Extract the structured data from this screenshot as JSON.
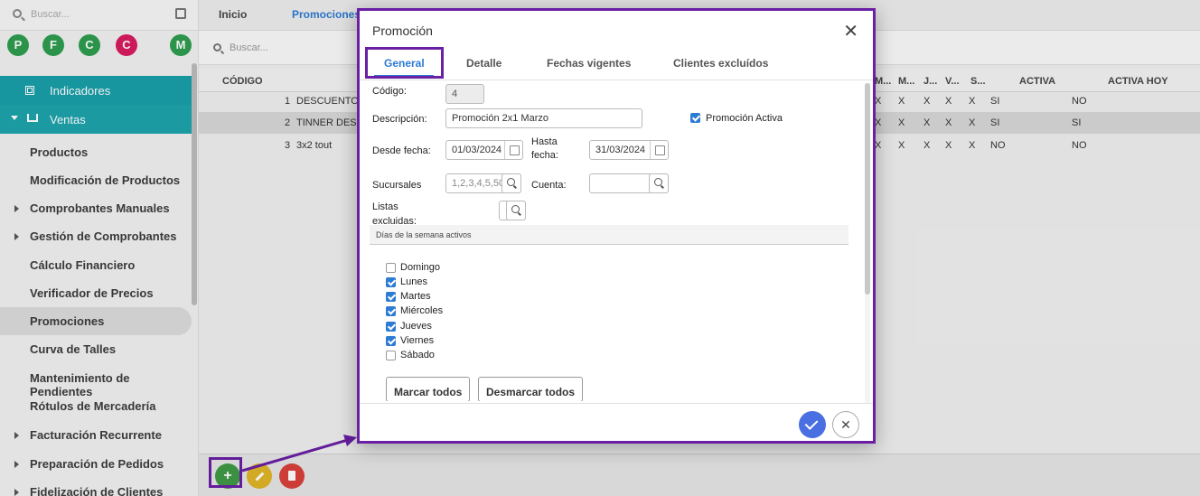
{
  "sidebar": {
    "search_placeholder": "Buscar...",
    "favorites": [
      {
        "letter": "P",
        "color": "#2e9e4f"
      },
      {
        "letter": "F",
        "color": "#2e9e4f"
      },
      {
        "letter": "C",
        "color": "#2e9e4f"
      },
      {
        "letter": "C",
        "color": "#d81b60"
      },
      {
        "letter": "M",
        "color": "#2e9e4f"
      }
    ],
    "section_indicadores": "Indicadores",
    "section_ventas": "Ventas",
    "items": [
      {
        "label": "Productos"
      },
      {
        "label": "Modificación de Productos"
      },
      {
        "label": "Comprobantes Manuales"
      },
      {
        "label": "Gestión de Comprobantes"
      },
      {
        "label": "Cálculo Financiero"
      },
      {
        "label": "Verificador de Precios"
      },
      {
        "label": "Promociones"
      },
      {
        "label": "Curva de Talles"
      },
      {
        "label": "Mantenimiento de Pendientes"
      },
      {
        "label": "Rótulos de Mercadería"
      },
      {
        "label": "Facturación Recurrente"
      },
      {
        "label": "Preparación de Pedidos"
      },
      {
        "label": "Fidelización de Clientes"
      }
    ]
  },
  "tabs": {
    "inicio": "Inicio",
    "promociones": "Promociones"
  },
  "main_search_placeholder": "Buscar...",
  "grid": {
    "headers": {
      "codigo": "CÓDIGO",
      "m1": "M...",
      "m2": "M...",
      "j": "J...",
      "v": "V...",
      "s": "S...",
      "activa": "ACTIVA",
      "activa_hoy": "ACTIVA HOY"
    },
    "rows": [
      {
        "codigo": "1",
        "desc": "DESCUENTO V",
        "x1": "X",
        "x2": "X",
        "x3": "X",
        "x4": "X",
        "x5": "X",
        "activa": "SI",
        "activa_hoy": "NO"
      },
      {
        "codigo": "2",
        "desc": "TINNER DESCU",
        "x1": "X",
        "x2": "X",
        "x3": "X",
        "x4": "X",
        "x5": "X",
        "activa": "SI",
        "activa_hoy": "SI"
      },
      {
        "codigo": "3",
        "desc": "3x2 tout",
        "x1": "X",
        "x2": "X",
        "x3": "X",
        "x4": "X",
        "x5": "X",
        "activa": "NO",
        "activa_hoy": "NO"
      }
    ]
  },
  "fab": {
    "add": "+"
  },
  "modal": {
    "title": "Promoción",
    "close": "✕",
    "tabs": [
      "General",
      "Detalle",
      "Fechas vigentes",
      "Clientes excluídos"
    ],
    "codigo_label": "Código:",
    "codigo_value": "4",
    "descripcion_label": "Descripción:",
    "descripcion_value": "Promoción 2x1 Marzo",
    "promo_activa_label": "Promoción Activa",
    "desde_label": "Desde fecha:",
    "desde_value": "01/03/2024",
    "hasta_label_1": "Hasta",
    "hasta_label_2": "fecha:",
    "hasta_value": "31/03/2024",
    "sucursales_label": "Sucursales",
    "sucursales_value": "1,2,3,4,5,50",
    "cuenta_label": "Cuenta:",
    "listas_label_1": "Listas",
    "listas_label_2": "excluidas:",
    "dias_header": "Días de la semana activos",
    "dias": [
      {
        "label": "Domingo",
        "checked": false
      },
      {
        "label": "Lunes",
        "checked": true
      },
      {
        "label": "Martes",
        "checked": true
      },
      {
        "label": "Miércoles",
        "checked": true
      },
      {
        "label": "Jueves",
        "checked": true
      },
      {
        "label": "Viernes",
        "checked": true
      },
      {
        "label": "Sábado",
        "checked": false
      }
    ],
    "marcar_todos": "Marcar todos",
    "desmarcar_todos": "Desmarcar todos",
    "cancel": "✕"
  },
  "colors": {
    "accent_purple": "#6a1fa5",
    "teal": "#1ea4ad",
    "blue": "#2d7bd4"
  }
}
